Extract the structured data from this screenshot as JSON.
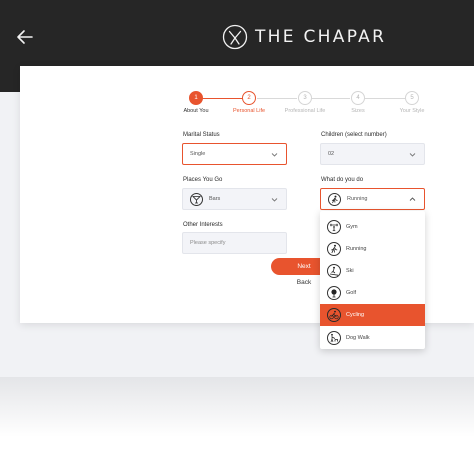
{
  "header": {
    "brand_name": "THE CHAPAR",
    "logo_icon": "chapar-logo-icon",
    "back_icon": "arrow-left-icon"
  },
  "colors": {
    "accent": "#e8542e",
    "header_bg": "#262626",
    "page_bg": "#f1f2f5"
  },
  "stepper": {
    "steps": [
      {
        "number": "1",
        "label": "About You",
        "state": "completed"
      },
      {
        "number": "2",
        "label": "Personal Life",
        "state": "current"
      },
      {
        "number": "3",
        "label": "Professional Life",
        "state": "upcoming"
      },
      {
        "number": "4",
        "label": "Sizes",
        "state": "upcoming"
      },
      {
        "number": "5",
        "label": "Your Style",
        "state": "upcoming"
      }
    ]
  },
  "form": {
    "marital_status": {
      "label": "Marital Status",
      "value": "Single"
    },
    "children": {
      "label": "Children (select number)",
      "value": "02"
    },
    "places": {
      "label": "Places You Go",
      "value": "Bars",
      "icon": "cocktail-glass-icon"
    },
    "activity": {
      "label": "What do you do",
      "value": "Running",
      "icon": "runner-icon"
    },
    "other_interests": {
      "label": "Other Interests",
      "placeholder": "Please specify"
    }
  },
  "buttons": {
    "next": "Next",
    "back": "Back"
  },
  "dropdown": {
    "items": [
      {
        "label": "Gym",
        "icon": "weightlifting-icon",
        "selected": false
      },
      {
        "label": "Running",
        "icon": "runner-icon",
        "selected": false
      },
      {
        "label": "Ski",
        "icon": "skier-icon",
        "selected": false
      },
      {
        "label": "Golf",
        "icon": "golf-icon",
        "selected": false
      },
      {
        "label": "Cycling",
        "icon": "cyclist-icon",
        "selected": true
      },
      {
        "label": "Dog Walk",
        "icon": "dog-walk-icon",
        "selected": false
      }
    ]
  }
}
